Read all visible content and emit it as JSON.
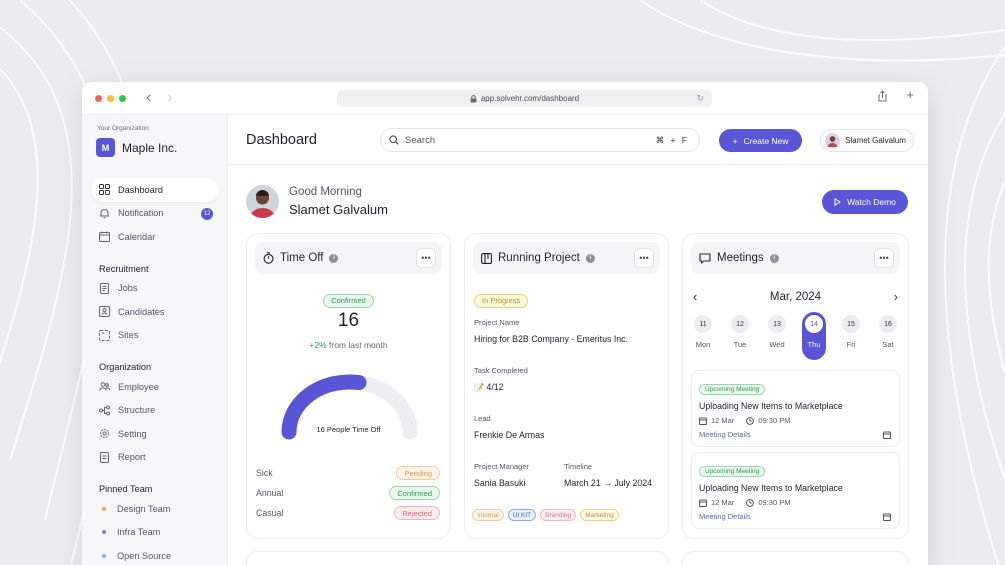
{
  "browser": {
    "url": "app.solvehr.com/dashboard",
    "dots": [
      "#ff5f57",
      "#febc2e",
      "#28c840"
    ]
  },
  "sidebar": {
    "org_label": "Your Organization",
    "org_initial": "M",
    "org_name": "Maple Inc.",
    "main_items": [
      {
        "label": "Dashboard",
        "icon": "grid-icon",
        "active": true
      },
      {
        "label": "Notification",
        "icon": "bell-icon",
        "badge": "12"
      },
      {
        "label": "Calendar",
        "icon": "calendar-icon"
      }
    ],
    "recruitment_title": "Recruitment",
    "recruitment_items": [
      {
        "label": "Jobs",
        "icon": "document-icon"
      },
      {
        "label": "Candidates",
        "icon": "id-card-icon"
      },
      {
        "label": "Sites",
        "icon": "sites-icon"
      }
    ],
    "organization_title": "Organization",
    "organization_items": [
      {
        "label": "Employee",
        "icon": "users-icon"
      },
      {
        "label": "Structure",
        "icon": "structure-icon"
      },
      {
        "label": "Setting",
        "icon": "gear-icon"
      },
      {
        "label": "Report",
        "icon": "report-icon"
      }
    ],
    "pinned_title": "Pinned Team",
    "pinned_items": [
      {
        "label": "Design Team",
        "color": "#f0a35c"
      },
      {
        "label": "Infra Team",
        "color": "#8e7be0"
      },
      {
        "label": "Open Source",
        "color": "#6fc3e8"
      }
    ]
  },
  "topbar": {
    "title": "Dashboard",
    "search_placeholder": "Search",
    "shortcut": "⌘ + F",
    "create_label": "Create New",
    "user_name": "Slamet Galvalum"
  },
  "greeting": {
    "sub": "Good Morning",
    "name": "Slamet Galvalum",
    "watch_label": "Watch Demo"
  },
  "time_off": {
    "title": "Time Off",
    "status": "Confirmed",
    "count": "16",
    "change": "+2%",
    "change_suffix": "from last month",
    "gauge_label": "16 People Time Off",
    "gauge_fraction": 0.55,
    "rows": [
      {
        "label": "Sick",
        "status": "Pending",
        "tone": "orange"
      },
      {
        "label": "Annual",
        "status": "Confirmed",
        "tone": "green"
      },
      {
        "label": "Casual",
        "status": "Rejected",
        "tone": "red"
      }
    ]
  },
  "running_project": {
    "title": "Running Project",
    "status": "In Progress",
    "project_name_label": "Project Name",
    "project_name": "Hiring for B2B Company - Emeritus Inc.",
    "task_label": "Task Completed",
    "task_value": "4/12",
    "lead_label": "Lead",
    "lead_value": "Frenkie De Armas",
    "pm_label": "Project Manager",
    "pm_value": "Sania Basuki",
    "timeline_label": "Timeline",
    "timeline_value": "March 21 → July 2024",
    "tags": [
      {
        "label": "Internal",
        "tone": "orange"
      },
      {
        "label": "UI KIT",
        "tone": "blue"
      },
      {
        "label": "Branding",
        "tone": "pink"
      },
      {
        "label": "Marketing",
        "tone": "gold"
      }
    ]
  },
  "meetings": {
    "title": "Meetings",
    "month": "Mar, 2024",
    "days": [
      {
        "num": "11",
        "name": "Mon"
      },
      {
        "num": "12",
        "name": "Tue"
      },
      {
        "num": "13",
        "name": "Wed"
      },
      {
        "num": "14",
        "name": "Thu",
        "active": true
      },
      {
        "num": "15",
        "name": "Fri"
      },
      {
        "num": "16",
        "name": "Sat"
      }
    ],
    "items": [
      {
        "badge": "Upcoming Meeting",
        "title": "Uploading New Items to Marketplace",
        "date": "12 Mar",
        "time": "09:30 PM",
        "link": "Meeting Details"
      },
      {
        "badge": "Upcoming Meeting",
        "title": "Uploading New Items to Marketplace",
        "date": "12 Mar",
        "time": "09:30 PM",
        "link": "Meeting Details"
      }
    ]
  },
  "colors": {
    "accent": "#5856d6",
    "success": "#2f9a52"
  }
}
